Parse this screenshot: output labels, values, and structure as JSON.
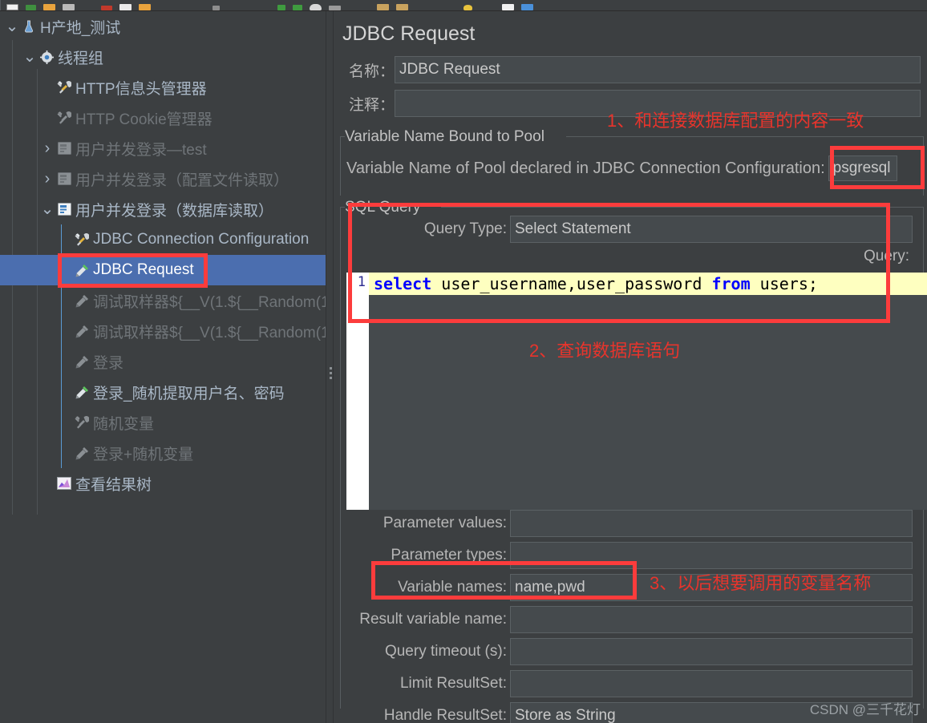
{
  "app": {
    "toolbar_icons": [
      "new-icon",
      "open-icon",
      "save-icon",
      "save-as-icon",
      "cut-icon",
      "copy-icon",
      "paste-icon",
      "expand-icon",
      "collapse-icon",
      "toggle-icon",
      "start-icon",
      "start-no-pause-icon",
      "stop-icon",
      "shutdown-icon",
      "clear-icon",
      "clear-all-icon",
      "search-icon",
      "function-helper-icon",
      "templates-icon"
    ]
  },
  "tree": {
    "items": [
      {
        "label": "H产地_测试",
        "icon": "test-plan-icon",
        "indent": 0,
        "twisty": "down",
        "state": "enabled",
        "selected": false
      },
      {
        "label": "线程组",
        "icon": "thread-group-icon",
        "indent": 1,
        "twisty": "down",
        "state": "enabled",
        "selected": false
      },
      {
        "label": "HTTP信息头管理器",
        "icon": "config-icon",
        "indent": 2,
        "twisty": "none",
        "state": "enabled",
        "selected": false
      },
      {
        "label": "HTTP Cookie管理器",
        "icon": "config-icon",
        "indent": 2,
        "twisty": "none",
        "state": "disabled",
        "selected": false
      },
      {
        "label": "用户并发登录—test",
        "icon": "controller-icon",
        "indent": 2,
        "twisty": "right",
        "state": "disabled",
        "selected": false
      },
      {
        "label": "用户并发登录（配置文件读取）",
        "icon": "controller-icon",
        "indent": 2,
        "twisty": "right",
        "state": "disabled",
        "selected": false
      },
      {
        "label": "用户并发登录（数据库读取）",
        "icon": "controller-icon",
        "indent": 2,
        "twisty": "down",
        "state": "enabled",
        "selected": false
      },
      {
        "label": "JDBC Connection Configuration",
        "icon": "config-icon",
        "indent": 3,
        "twisty": "none",
        "state": "enabled",
        "selected": false
      },
      {
        "label": "JDBC Request",
        "icon": "sampler-icon",
        "indent": 3,
        "twisty": "none",
        "state": "enabled",
        "selected": true
      },
      {
        "label": "调试取样器${__V(1.${__Random(1",
        "icon": "sampler-icon",
        "indent": 3,
        "twisty": "none",
        "state": "disabled",
        "selected": false
      },
      {
        "label": "调试取样器${__V(1.${__Random(1",
        "icon": "sampler-icon",
        "indent": 3,
        "twisty": "none",
        "state": "disabled",
        "selected": false
      },
      {
        "label": "登录",
        "icon": "sampler-icon",
        "indent": 3,
        "twisty": "none",
        "state": "disabled",
        "selected": false
      },
      {
        "label": "登录_随机提取用户名、密码",
        "icon": "sampler-icon",
        "indent": 3,
        "twisty": "none",
        "state": "enabled",
        "selected": false
      },
      {
        "label": "随机变量",
        "icon": "config-icon",
        "indent": 3,
        "twisty": "none",
        "state": "disabled",
        "selected": false
      },
      {
        "label": "登录+随机变量",
        "icon": "sampler-icon",
        "indent": 3,
        "twisty": "none",
        "state": "disabled",
        "selected": false
      },
      {
        "label": "查看结果树",
        "icon": "listener-icon",
        "indent": 2,
        "twisty": "none",
        "state": "enabled",
        "selected": false
      }
    ]
  },
  "main": {
    "title": "JDBC Request",
    "name_label": "名称：",
    "name_value": "JDBC Request",
    "comment_label": "注释：",
    "comment_value": "",
    "pool_group_title": "Variable Name Bound to Pool",
    "pool_label": "Variable Name of Pool declared in JDBC Connection Configuration:",
    "pool_value": "psgresql",
    "sql_group_title": "SQL Query",
    "query_type_label": "Query Type:",
    "query_type_value": "Select Statement",
    "query_label": "Query:",
    "query_line_number": "1",
    "query_sql_pre": "select",
    "query_sql_mid": " user_username,user_password ",
    "query_sql_kw2": "from",
    "query_sql_tail": " users;",
    "fields": [
      {
        "label": "Parameter values:",
        "value": ""
      },
      {
        "label": "Parameter types:",
        "value": ""
      },
      {
        "label": "Variable names:",
        "value": "name,pwd"
      },
      {
        "label": "Result variable name:",
        "value": ""
      },
      {
        "label": "Query timeout (s):",
        "value": ""
      },
      {
        "label": "Limit ResultSet:",
        "value": ""
      },
      {
        "label": "Handle ResultSet:",
        "value": "Store as String"
      }
    ]
  },
  "annotations": [
    {
      "id": "note-1",
      "text": "1、和连接数据库配置的内容一致"
    },
    {
      "id": "note-2",
      "text": "2、查询数据库语句"
    },
    {
      "id": "note-3",
      "text": "3、以后想要调用的变量名称"
    }
  ],
  "watermark": "CSDN @三千花灯",
  "colors": {
    "background": "#3c3f41",
    "selection": "#4b6eaf",
    "annotation_red": "#e8342c",
    "box_red": "#fc3c3c",
    "sql_highlight": "#feffc0",
    "sql_keyword": "#0000ff"
  }
}
